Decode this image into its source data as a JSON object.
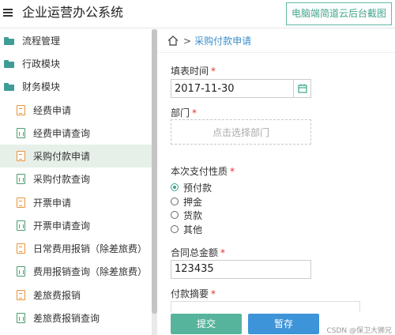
{
  "header": {
    "title": "企业运营办公系统",
    "promo_button": "电脑端简道云后台截图"
  },
  "sidebar": {
    "groups": [
      {
        "label": "流程管理",
        "icon": "folder-icon"
      },
      {
        "label": "行政模块",
        "icon": "folder-icon"
      },
      {
        "label": "财务模块",
        "icon": "folder-icon"
      }
    ],
    "items": [
      {
        "label": "经费申请",
        "icon": "form-icon",
        "active": false
      },
      {
        "label": "经费申请查询",
        "icon": "report-icon",
        "active": false
      },
      {
        "label": "采购付款申请",
        "icon": "form-icon",
        "active": true
      },
      {
        "label": "采购付款查询",
        "icon": "report-icon",
        "active": false
      },
      {
        "label": "开票申请",
        "icon": "form-icon",
        "active": false
      },
      {
        "label": "开票申请查询",
        "icon": "report-icon",
        "active": false
      },
      {
        "label": "日常费用报销（除差旅费）",
        "icon": "form-icon",
        "active": false
      },
      {
        "label": "费用报销查询（除差旅费）",
        "icon": "report-icon",
        "active": false
      },
      {
        "label": "差旅费报销",
        "icon": "form-icon",
        "active": false
      },
      {
        "label": "差旅费报销查询",
        "icon": "report-icon",
        "active": false
      }
    ]
  },
  "breadcrumb": {
    "separator": ">",
    "current": "采购付款申请"
  },
  "form": {
    "fill_date": {
      "label": "填表时间",
      "required": "*",
      "value": "2017-11-30"
    },
    "department": {
      "label": "部门",
      "required": "*",
      "placeholder": "点击选择部门"
    },
    "payment_type": {
      "label": "本次支付性质",
      "required": "*",
      "options": [
        "预付款",
        "押金",
        "货款",
        "其他"
      ],
      "selected": "预付款"
    },
    "contract_amount": {
      "label": "合同总金额",
      "required": "*",
      "value": "123435"
    },
    "payment_summary": {
      "label": "付款摘要",
      "required": "*"
    }
  },
  "actions": {
    "submit": "提交",
    "save": "暂存"
  },
  "watermark": "CSDN @保卫大狮兄",
  "colors": {
    "accent_green": "#57b49c",
    "accent_blue": "#3d94d8",
    "required_red": "#e0322b",
    "active_row": "#e7efe9"
  }
}
